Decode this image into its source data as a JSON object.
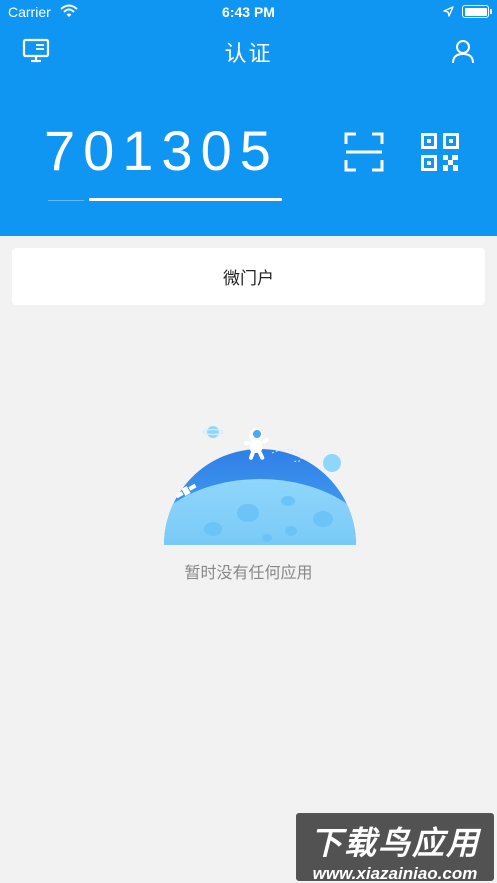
{
  "status_bar": {
    "carrier": "Carrier",
    "time": "6:43 PM"
  },
  "nav": {
    "title": "认证",
    "left_icon": "monitor-icon",
    "right_icon": "user-icon"
  },
  "auth": {
    "code": "701305",
    "scan_icon": "scan-icon",
    "qr_icon": "qr-code-icon"
  },
  "tabs": [
    {
      "label": "微门户"
    }
  ],
  "empty_state": {
    "illustration": "astronaut-planet-illustration",
    "message": "暂时没有任何应用"
  },
  "watermark": {
    "title": "下载鸟应用",
    "url": "www.xiazainiao.com"
  },
  "colors": {
    "primary": "#0f96f2",
    "background": "#f2f2f2",
    "card": "#ffffff"
  }
}
